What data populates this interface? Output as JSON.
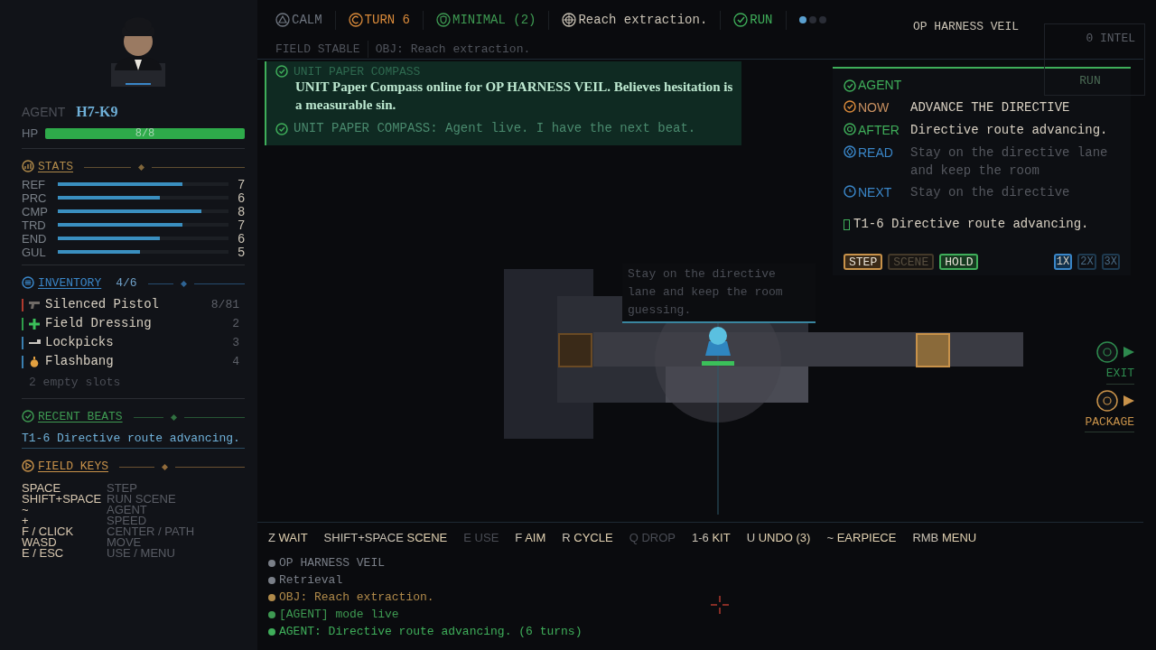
{
  "agent": {
    "label": "AGENT",
    "callsign": "H7-K9",
    "hp": {
      "label": "HP",
      "text": "8/8",
      "level": 1
    }
  },
  "stats": {
    "title": "STATS",
    "rows": [
      {
        "name": "REF",
        "value": "7",
        "level": 0.73
      },
      {
        "name": "PRC",
        "value": "6",
        "level": 0.6
      },
      {
        "name": "CMP",
        "value": "8",
        "level": 0.84
      },
      {
        "name": "TRD",
        "value": "7",
        "level": 0.73
      },
      {
        "name": "END",
        "value": "6",
        "level": 0.6
      },
      {
        "name": "GUL",
        "value": "5",
        "level": 0.48
      }
    ]
  },
  "inventory": {
    "title": "INVENTORY",
    "count": "4/6",
    "items": [
      {
        "kind": "pistol",
        "name": "Silenced Pistol",
        "qty": "8/81",
        "color": "#b03a2e"
      },
      {
        "kind": "medkit",
        "name": "Field Dressing",
        "qty": "2",
        "color": "#2e9e4a"
      },
      {
        "kind": "lockpick",
        "name": "Lockpicks",
        "qty": "3",
        "color": "#3a7fb0"
      },
      {
        "kind": "grenade",
        "name": "Flashbang",
        "qty": "4",
        "color": "#3a7fb0"
      }
    ],
    "empty": "2 empty slots"
  },
  "recent_beats": {
    "title": "RECENT BEATS",
    "items": [
      "T1-6 Directive route advancing."
    ]
  },
  "field_keys": {
    "title": "FIELD KEYS",
    "rows": [
      {
        "key": "SPACE",
        "action": "STEP"
      },
      {
        "key": "SHIFT+SPACE",
        "action": "RUN SCENE"
      },
      {
        "key": "~",
        "action": "AGENT"
      },
      {
        "key": "+",
        "action": "SPEED"
      },
      {
        "key": "F / CLICK",
        "action": "CENTER / PATH"
      },
      {
        "key": "WASD",
        "action": "MOVE"
      },
      {
        "key": "E / ESC",
        "action": "USE / MENU"
      }
    ]
  },
  "top_bar": {
    "items": [
      {
        "kind": "alert",
        "label": "CALM",
        "color": "#6f7680"
      },
      {
        "kind": "clock",
        "label": "TURN 6",
        "color": "#d98a3a"
      },
      {
        "kind": "shield",
        "label": "MINIMAL (2)",
        "color": "#3e9a52"
      },
      {
        "kind": "target",
        "label": "Reach extraction.",
        "color": "#c9c2b4"
      },
      {
        "kind": "check",
        "label": "RUN",
        "color": "#3fae5a"
      }
    ],
    "pager": [
      {
        "selected": true
      },
      {
        "selected": false
      },
      {
        "selected": false
      }
    ],
    "operation": "OP HARNESS VEIL"
  },
  "minimap": {
    "intel": "0 INTEL",
    "mode": "RUN"
  },
  "status_line": {
    "field": "FIELD STABLE",
    "objective": "OBJ: Reach extraction."
  },
  "messages": [
    {
      "kind": "headline",
      "sender": "UNIT PAPER COMPASS",
      "text": "UNIT Paper Compass online for OP HARNESS VEIL. Believes hesitation is a measurable sin."
    },
    {
      "kind": "line",
      "text": "UNIT PAPER COMPASS: Agent live. I have the next beat."
    }
  ],
  "agent_panel": {
    "title": "AGENT",
    "rows": [
      {
        "kind": "now",
        "label": "NOW",
        "text": "ADVANCE THE DIRECTIVE"
      },
      {
        "kind": "after",
        "label": "AFTER",
        "text": "Directive route advancing."
      },
      {
        "kind": "read",
        "label": "READ",
        "text": "Stay on the directive lane and keep the room"
      },
      {
        "kind": "next",
        "label": "NEXT",
        "text": "Stay on the directive"
      }
    ],
    "beat": "T1-6 Directive route advancing.",
    "controls": [
      {
        "kind": "step",
        "label": "STEP",
        "disabled": false
      },
      {
        "kind": "scene",
        "label": "SCENE",
        "disabled": true
      },
      {
        "kind": "hold",
        "label": "HOLD",
        "disabled": false
      }
    ],
    "speeds": [
      {
        "label": "1X",
        "selected": true
      },
      {
        "label": "2X",
        "selected": false
      },
      {
        "label": "3X",
        "selected": false
      }
    ]
  },
  "map": {
    "tooltip": "Stay on the directive lane and keep the room guessing.",
    "exits": [
      {
        "kind": "exit",
        "label": "EXIT"
      },
      {
        "kind": "package",
        "label": "PACKAGE"
      }
    ]
  },
  "key_bar": [
    {
      "key": "Z",
      "action": "WAIT",
      "disabled": false
    },
    {
      "key": "SHIFT+SPACE",
      "action": "SCENE",
      "disabled": false
    },
    {
      "key": "E",
      "action": "USE",
      "disabled": true
    },
    {
      "key": "F",
      "action": "AIM",
      "disabled": false
    },
    {
      "key": "R",
      "action": "CYCLE",
      "disabled": false
    },
    {
      "key": "Q",
      "action": "DROP",
      "disabled": true
    },
    {
      "key": "1-6",
      "action": "KIT",
      "disabled": false
    },
    {
      "key": "U",
      "action": "UNDO (3)",
      "disabled": false
    },
    {
      "key": "~",
      "action": "EARPIECE",
      "disabled": false
    },
    {
      "key": "RMB",
      "action": "MENU",
      "disabled": false
    }
  ],
  "log": [
    {
      "text": "OP HARNESS VEIL",
      "color": "#7a7f88"
    },
    {
      "text": "Retrieval",
      "color": "#7a7f88"
    },
    {
      "text": "OBJ: Reach extraction.",
      "color": "#b08a4a"
    },
    {
      "text": "[AGENT] mode live",
      "color": "#3e9a52"
    },
    {
      "text": "AGENT: Directive route advancing. (6 turns)",
      "color": "#3fae5a"
    }
  ]
}
